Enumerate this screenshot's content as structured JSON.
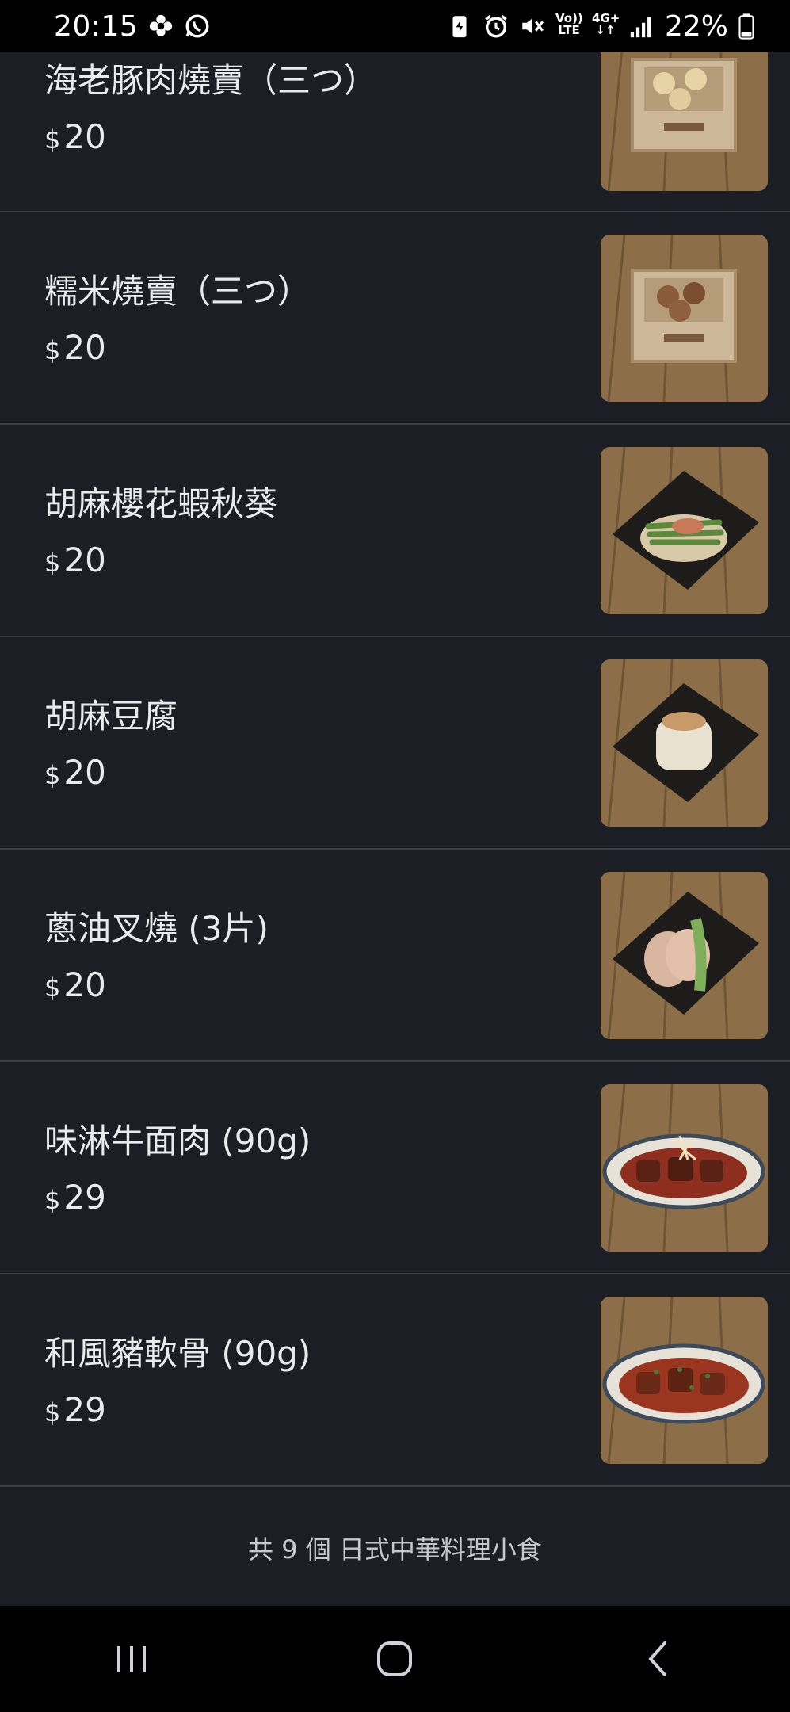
{
  "status_bar": {
    "time": "20:15",
    "battery_percent": "22%",
    "volte_label": "Vo))\nLTE",
    "network_label": "4G+",
    "icons": [
      "flower-notification-icon",
      "whatsapp-icon",
      "battery-saver-icon",
      "alarm-icon",
      "mute-icon",
      "volte-icon",
      "4g-plus-icon",
      "signal-icon",
      "battery-icon"
    ]
  },
  "menu": {
    "currency_symbol": "$",
    "items": [
      {
        "name": "海老豚肉燒賣（三つ）",
        "price": "20",
        "photo": "shumai-box-photo"
      },
      {
        "name": "糯米燒賣（三つ）",
        "price": "20",
        "photo": "sticky-rice-shumai-photo"
      },
      {
        "name": "胡麻櫻花蝦秋葵",
        "price": "20",
        "photo": "okra-photo"
      },
      {
        "name": "胡麻豆腐",
        "price": "20",
        "photo": "sesame-tofu-photo"
      },
      {
        "name": "蔥油叉燒 (3片)",
        "price": "20",
        "photo": "char-siu-photo"
      },
      {
        "name": "味淋牛面肉 (90g)",
        "price": "29",
        "photo": "beef-cheek-photo"
      },
      {
        "name": "和風豬軟骨 (90g)",
        "price": "29",
        "photo": "pork-cartilage-photo"
      }
    ]
  },
  "footer": {
    "summary": "共 9 個 日式中華料理小食"
  },
  "nav": {
    "buttons": [
      "recents-button",
      "home-button",
      "back-button"
    ]
  },
  "colors": {
    "background": "#1b1e25",
    "divider": "#3a3e46",
    "text": "#e8eaee",
    "footer_text": "#c6c9cf"
  }
}
